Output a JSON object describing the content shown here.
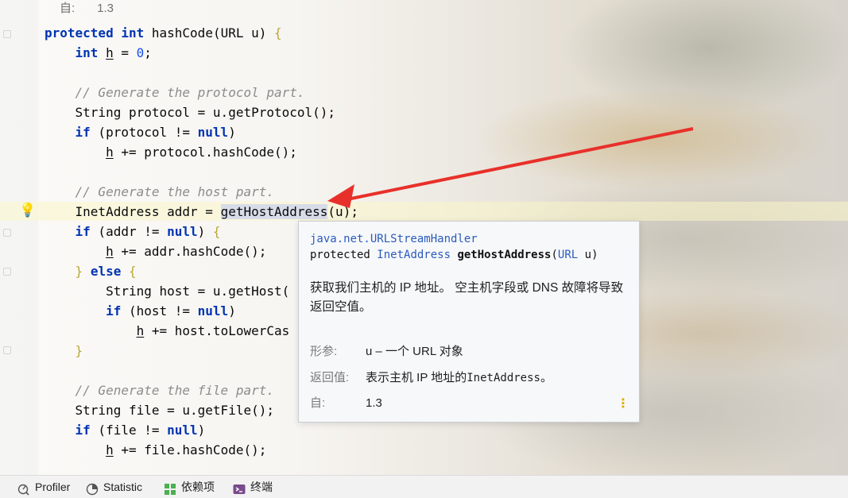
{
  "meta_line": {
    "since_label": "自:",
    "since_value": "1.3"
  },
  "code_lines": [
    [
      {
        "t": "protected",
        "c": "kw"
      },
      {
        "t": " "
      },
      {
        "t": "int",
        "c": "kw"
      },
      {
        "t": " hashCode(URL u) "
      },
      {
        "t": "{",
        "c": "br"
      }
    ],
    [
      {
        "t": "    "
      },
      {
        "t": "int",
        "c": "kw"
      },
      {
        "t": " "
      },
      {
        "t": "h",
        "c": "uvar"
      },
      {
        "t": " = "
      },
      {
        "t": "0",
        "c": "num"
      },
      {
        "t": ";"
      }
    ],
    [],
    [
      {
        "t": "    "
      },
      {
        "t": "// Generate the protocol part.",
        "c": "cm"
      }
    ],
    [
      {
        "t": "    String protocol = u.getProtocol();"
      }
    ],
    [
      {
        "t": "    "
      },
      {
        "t": "if",
        "c": "kw"
      },
      {
        "t": " (protocol != "
      },
      {
        "t": "null",
        "c": "kw"
      },
      {
        "t": ")"
      }
    ],
    [
      {
        "t": "        "
      },
      {
        "t": "h",
        "c": "uvar"
      },
      {
        "t": " += protocol.hashCode();"
      }
    ],
    [],
    [
      {
        "t": "    "
      },
      {
        "t": "// Generate the host part.",
        "c": "cm"
      }
    ],
    [
      {
        "t": "    InetAddress addr = "
      },
      {
        "t": "getHostAddress",
        "c": "hl"
      },
      {
        "t": "(u);"
      }
    ],
    [
      {
        "t": "    "
      },
      {
        "t": "if",
        "c": "kw"
      },
      {
        "t": " (addr != "
      },
      {
        "t": "null",
        "c": "kw"
      },
      {
        "t": ") "
      },
      {
        "t": "{",
        "c": "br"
      }
    ],
    [
      {
        "t": "        "
      },
      {
        "t": "h",
        "c": "uvar"
      },
      {
        "t": " += addr.hashCode();"
      }
    ],
    [
      {
        "t": "    "
      },
      {
        "t": "}",
        "c": "br"
      },
      {
        "t": " "
      },
      {
        "t": "else",
        "c": "kw"
      },
      {
        "t": " "
      },
      {
        "t": "{",
        "c": "br"
      }
    ],
    [
      {
        "t": "        String host = u.getHost("
      }
    ],
    [
      {
        "t": "        "
      },
      {
        "t": "if",
        "c": "kw"
      },
      {
        "t": " (host != "
      },
      {
        "t": "null",
        "c": "kw"
      },
      {
        "t": ")"
      }
    ],
    [
      {
        "t": "            "
      },
      {
        "t": "h",
        "c": "uvar"
      },
      {
        "t": " += host.toLowerCas"
      }
    ],
    [
      {
        "t": "    "
      },
      {
        "t": "}",
        "c": "br"
      }
    ],
    [],
    [
      {
        "t": "    "
      },
      {
        "t": "// Generate the file part.",
        "c": "cm"
      }
    ],
    [
      {
        "t": "    String file = u.getFile();"
      }
    ],
    [
      {
        "t": "    "
      },
      {
        "t": "if",
        "c": "kw"
      },
      {
        "t": " (file != "
      },
      {
        "t": "null",
        "c": "kw"
      },
      {
        "t": ")"
      }
    ],
    [
      {
        "t": "        "
      },
      {
        "t": "h",
        "c": "uvar"
      },
      {
        "t": " += file.hashCode();"
      }
    ]
  ],
  "doc_popup": {
    "package": "java.net.URLStreamHandler",
    "sig_modifier": "protected ",
    "sig_return_type": "InetAddress",
    "sig_method": "getHostAddress",
    "sig_param_type": "URL",
    "sig_param_name": "u",
    "description": "获取我们主机的 IP 地址。 空主机字段或 DNS 故障将导致返回空值。",
    "params_label": "形参:",
    "params_value": "u – 一个 URL 对象",
    "returns_label": "返回值:",
    "returns_prefix": "表示主机 IP 地址的",
    "returns_code": "InetAddress",
    "returns_suffix": "。",
    "since_label": "自:",
    "since_value": "1.3",
    "more_icon": "kebab-vertical-icon"
  },
  "toolbar": {
    "items": [
      {
        "label": "Profiler",
        "icon": "profiler-icon"
      },
      {
        "label": "Statistic",
        "icon": "statistic-icon"
      },
      {
        "label": "依赖项",
        "icon": "dependencies-icon"
      },
      {
        "label": "终端",
        "icon": "terminal-icon"
      }
    ]
  },
  "colors": {
    "keyword": "#0033b3",
    "comment": "#8c8c8c",
    "number": "#1750eb",
    "arrow": "#e8302a",
    "link": "#2a5bbd"
  }
}
